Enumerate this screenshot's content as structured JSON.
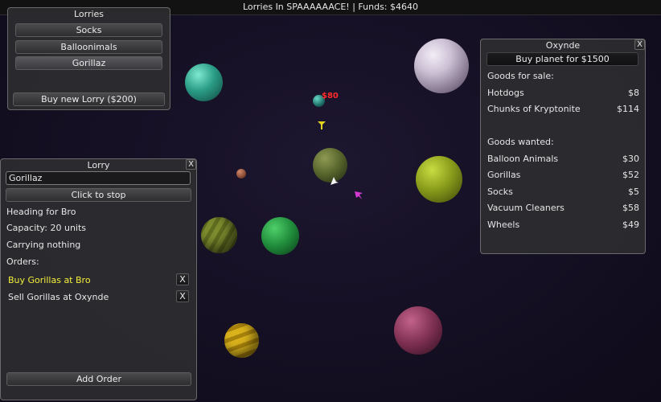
{
  "topbar": {
    "text": "Lorries In SPAAAAAACE! | Funds: $4640"
  },
  "lorries_panel": {
    "title": "Lorries",
    "items": [
      "Socks",
      "Balloonimals",
      "Gorillaz"
    ],
    "buy_label": "Buy new Lorry ($200)"
  },
  "lorry_panel": {
    "title": "Lorry",
    "close": "X",
    "name_value": "Gorillaz",
    "stop_label": "Click to stop",
    "heading": "Heading for Bro",
    "capacity": "Capacity: 20 units",
    "carrying": "Carrying nothing",
    "orders_label": "Orders:",
    "orders": [
      {
        "text": "Buy Gorillas at Bro",
        "x": "X"
      },
      {
        "text": "Sell Gorillas at Oxynde",
        "x": "X"
      }
    ],
    "add_order_label": "Add Order"
  },
  "planet_panel": {
    "title": "Oxynde",
    "close": "X",
    "buy_label": "Buy planet for $1500",
    "for_sale_label": "Goods for sale:",
    "for_sale": [
      {
        "name": "Hotdogs",
        "price": "$8"
      },
      {
        "name": "Chunks of Kryptonite",
        "price": "$114"
      }
    ],
    "wanted_label": "Goods wanted:",
    "wanted": [
      {
        "name": "Balloon Animals",
        "price": "$30"
      },
      {
        "name": "Gorillas",
        "price": "$52"
      },
      {
        "name": "Socks",
        "price": "$5"
      },
      {
        "name": "Vacuum Cleaners",
        "price": "$58"
      },
      {
        "name": "Wheels",
        "price": "$49"
      }
    ]
  },
  "map": {
    "price_tag": "$80"
  },
  "colors": {
    "accent_yellow": "#f4ef3b",
    "price_red": "#ff2a2a",
    "panel_bg": "#2c2c2f"
  }
}
